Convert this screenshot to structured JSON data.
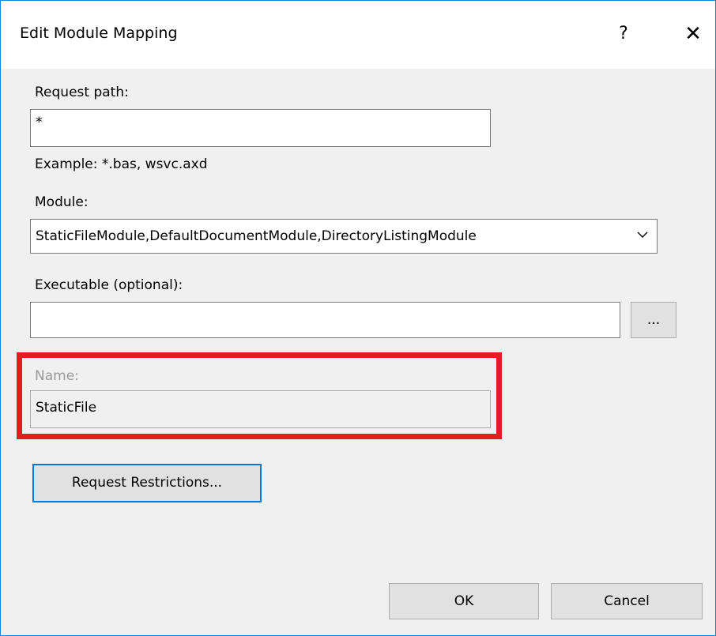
{
  "dialog": {
    "title": "Edit Module Mapping",
    "help_label": "?",
    "close_label": "✕"
  },
  "request_path": {
    "label": "Request path:",
    "value": "*",
    "example": "Example: *.bas, wsvc.axd"
  },
  "module": {
    "label": "Module:",
    "selected": "StaticFileModule,DefaultDocumentModule,DirectoryListingModule"
  },
  "executable": {
    "label": "Executable (optional):",
    "value": "",
    "browse_label": "..."
  },
  "name": {
    "label": "Name:",
    "value": "StaticFile"
  },
  "buttons": {
    "request_restrictions": "Request Restrictions...",
    "ok": "OK",
    "cancel": "Cancel"
  },
  "colors": {
    "highlight": "#e51b24",
    "accent": "#0078d7",
    "window_border": "#1883d7"
  }
}
